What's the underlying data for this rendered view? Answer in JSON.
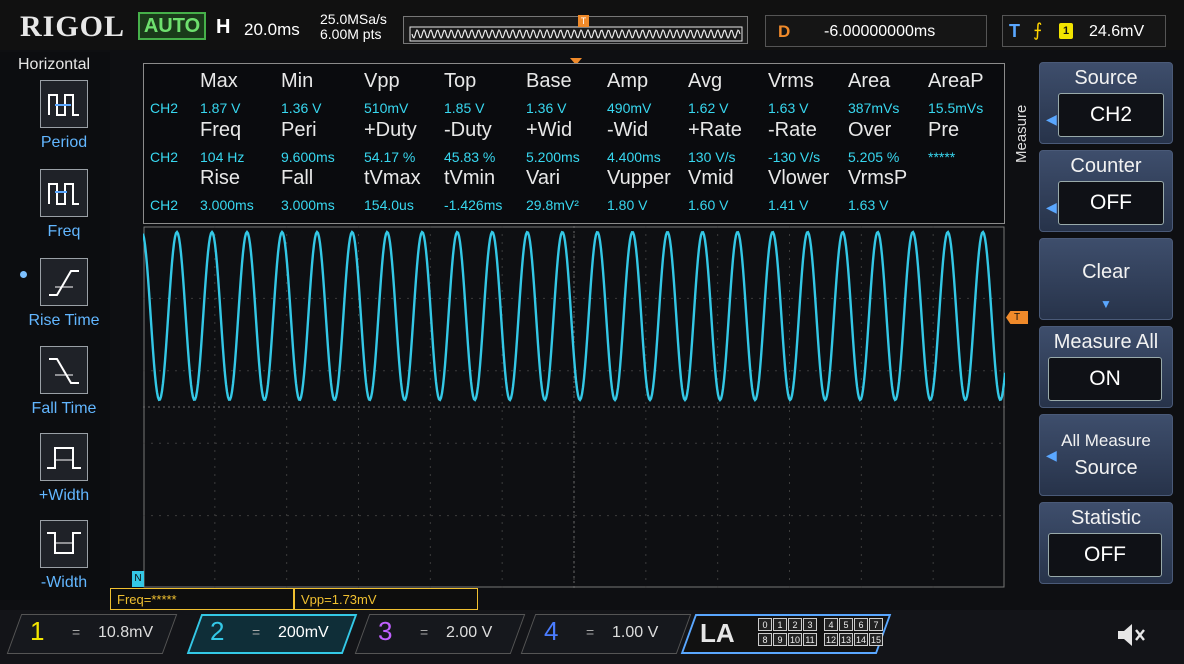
{
  "header": {
    "brand": "RIGOL",
    "mode": "AUTO",
    "horizontal_label": "H",
    "timebase": "20.0ms",
    "sample_rate": "25.0MSa/s",
    "memory_depth": "6.00M pts",
    "delay_label": "D",
    "delay_value": "-6.00000000ms",
    "trigger_label": "T",
    "trigger_source": "1",
    "trigger_level": "24.6mV"
  },
  "left_menu": {
    "title": "Horizontal",
    "items": [
      {
        "label": "Period",
        "icon": "period-icon"
      },
      {
        "label": "Freq",
        "icon": "frequency-icon"
      },
      {
        "label": "Rise Time",
        "icon": "rise-time-icon"
      },
      {
        "label": "Fall Time",
        "icon": "fall-time-icon"
      },
      {
        "label": "+Width",
        "icon": "positive-width-icon"
      },
      {
        "label": "-Width",
        "icon": "negative-width-icon"
      }
    ]
  },
  "measurements": {
    "channel": "CH2",
    "rows": [
      {
        "labels": [
          "Max",
          "Min",
          "Vpp",
          "Top",
          "Base",
          "Amp",
          "Avg",
          "Vrms",
          "Area",
          "AreaP"
        ],
        "values": [
          "1.87 V",
          "1.36 V",
          "510mV",
          "1.85 V",
          "1.36 V",
          "490mV",
          "1.62 V",
          "1.63 V",
          "387mVs",
          "15.5mVs"
        ]
      },
      {
        "labels": [
          "Freq",
          "Peri",
          "+Duty",
          "-Duty",
          "+Wid",
          "-Wid",
          "+Rate",
          "-Rate",
          "Over",
          "Pre"
        ],
        "values": [
          "104 Hz",
          "9.600ms",
          "54.17 %",
          "45.83 %",
          "5.200ms",
          "4.400ms",
          "130 V/s",
          "-130 V/s",
          "5.205 %",
          "*****"
        ]
      },
      {
        "labels": [
          "Rise",
          "Fall",
          "tVmax",
          "tVmin",
          "Vari",
          "Vupper",
          "Vmid",
          "Vlower",
          "VrmsP"
        ],
        "values": [
          "3.000ms",
          "3.000ms",
          "154.0us",
          "-1.426ms",
          "29.8mV²",
          "1.80 V",
          "1.60 V",
          "1.41 V",
          "1.63 V"
        ]
      }
    ]
  },
  "waveform": {
    "color": "#34c8e6",
    "cycles": 24.6,
    "trigger_marker": "T",
    "channel_marker": "N"
  },
  "last_readouts": {
    "freq": "Freq=*****",
    "vpp": "Vpp=1.73mV"
  },
  "right_menu": {
    "side_title": "Measure",
    "source_title": "Source",
    "source_value": "CH2",
    "counter_title": "Counter",
    "counter_value": "OFF",
    "clear_label": "Clear",
    "measure_all_title": "Measure All",
    "measure_all_value": "ON",
    "all_measure_source_line1": "All Measure",
    "all_measure_source_line2": "Source",
    "statistic_title": "Statistic",
    "statistic_value": "OFF"
  },
  "channels": [
    {
      "num": "1",
      "coupling": "=",
      "scale": "10.8mV",
      "color": "#f2e400"
    },
    {
      "num": "2",
      "coupling": "=",
      "scale": "200mV",
      "color": "#34c8e6"
    },
    {
      "num": "3",
      "coupling": "=",
      "scale": "2.00 V",
      "color": "#c060ff"
    },
    {
      "num": "4",
      "coupling": "=",
      "scale": "1.00 V",
      "color": "#4a7cff"
    }
  ],
  "logic_analyzer": {
    "label": "LA",
    "bits_row1": [
      "0",
      "1",
      "2",
      "3",
      "4",
      "5",
      "6",
      "7"
    ],
    "bits_row2": [
      "8",
      "9",
      "10",
      "11",
      "12",
      "13",
      "14",
      "15"
    ]
  },
  "sound_icon": "speaker-muted-icon"
}
